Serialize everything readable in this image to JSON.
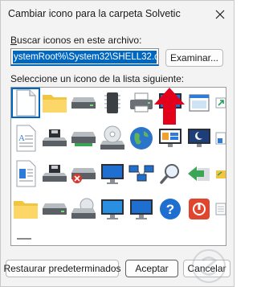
{
  "window": {
    "title": "Cambiar icono para la carpeta Solvetic",
    "close_glyph": "✕"
  },
  "search": {
    "label_hot": "B",
    "label_rest": "uscar iconos en este archivo:",
    "path_value": "ystemRoot%\\System32\\SHELL32.dll",
    "browse_label": "Examinar..."
  },
  "list": {
    "label": "Seleccione un icono de la lista siguiente:",
    "selected_index": 0,
    "icons": [
      [
        "blank-document-icon",
        "folder-icon",
        "drive-icon",
        "memory-chip-icon",
        "printer-icon",
        "monitor-icon",
        "window-icon",
        "shortcut-overlay-icon"
      ],
      [
        "text-document-icon",
        "floppy-drive-icon",
        "drive-green-icon",
        "cd-drive-icon",
        "globe-icon",
        "display-settings-icon",
        "moon-monitor-icon",
        "document-arrow-icon"
      ],
      [
        "document-blue-icon",
        "floppy-disk-icon",
        "drive-x-icon",
        "network-monitor-icon",
        "network-icon",
        "magnifier-icon",
        "green-arrow-icon",
        "folder-arrow-icon"
      ],
      [
        "folder-yellow-icon",
        "drive-gray-icon",
        "cd-disk-icon",
        "monitor-grid-icon",
        "monitor-blank-icon",
        "help-icon",
        "power-icon",
        "document-grid-icon"
      ]
    ]
  },
  "buttons": {
    "restore": "Restaurar predeterminados",
    "ok": "Aceptar",
    "cancel": "Cancelar"
  },
  "colors": {
    "accent": "#0067c0",
    "pointer_arrow": "#e3001b"
  }
}
